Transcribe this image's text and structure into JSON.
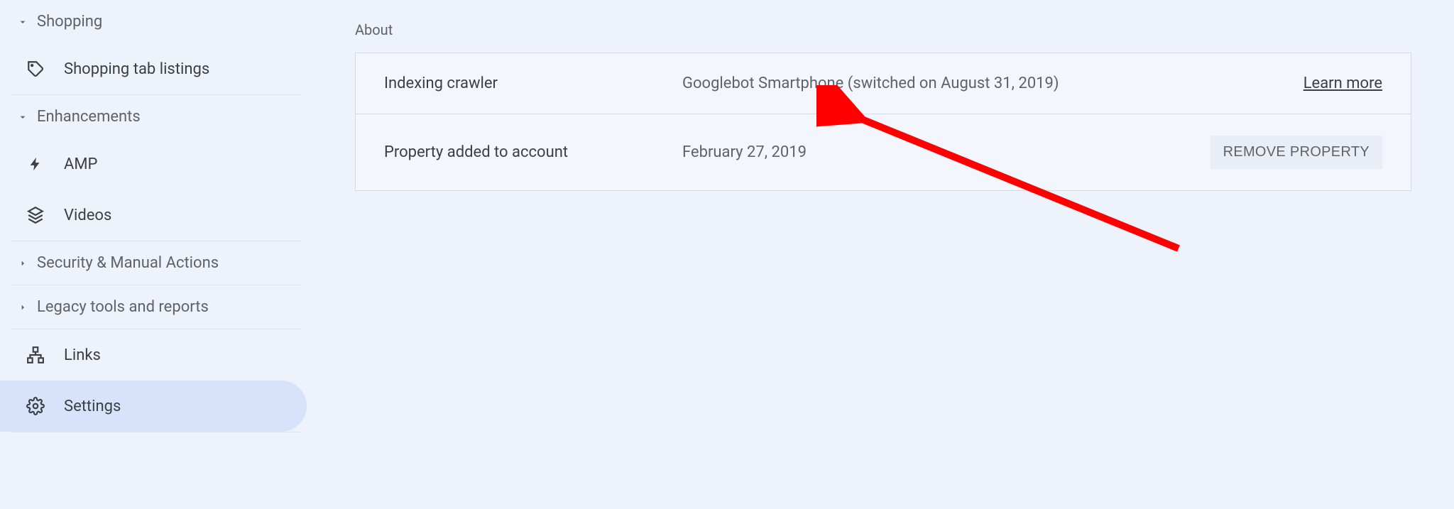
{
  "sidebar": {
    "shopping": {
      "label": "Shopping",
      "items": [
        {
          "label": "Shopping tab listings"
        }
      ]
    },
    "enhancements": {
      "label": "Enhancements",
      "items": [
        {
          "label": "AMP"
        },
        {
          "label": "Videos"
        }
      ]
    },
    "security": {
      "label": "Security & Manual Actions"
    },
    "legacy": {
      "label": "Legacy tools and reports"
    },
    "links": {
      "label": "Links"
    },
    "settings": {
      "label": "Settings"
    }
  },
  "main": {
    "about_label": "About",
    "rows": {
      "crawler": {
        "label": "Indexing crawler",
        "value": "Googlebot Smartphone (switched on August 31, 2019)",
        "action": "Learn more"
      },
      "added": {
        "label": "Property added to account",
        "value": "February 27, 2019",
        "action": "REMOVE PROPERTY"
      }
    }
  }
}
